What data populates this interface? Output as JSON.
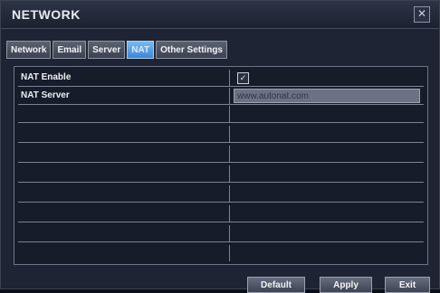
{
  "window": {
    "title": "NETWORK",
    "close_label": "✕"
  },
  "tabs": [
    {
      "label": "Network",
      "active": false
    },
    {
      "label": "Email",
      "active": false
    },
    {
      "label": "Server",
      "active": false
    },
    {
      "label": "NAT",
      "active": true
    },
    {
      "label": "Other Settings",
      "active": false
    }
  ],
  "settings": {
    "nat_enable": {
      "label": "NAT Enable",
      "checked": true,
      "check_glyph": "✓"
    },
    "nat_server": {
      "label": "NAT Server",
      "value": "www.autonat.com"
    }
  },
  "buttons": {
    "default": "Default",
    "apply": "Apply",
    "exit": "Exit"
  }
}
